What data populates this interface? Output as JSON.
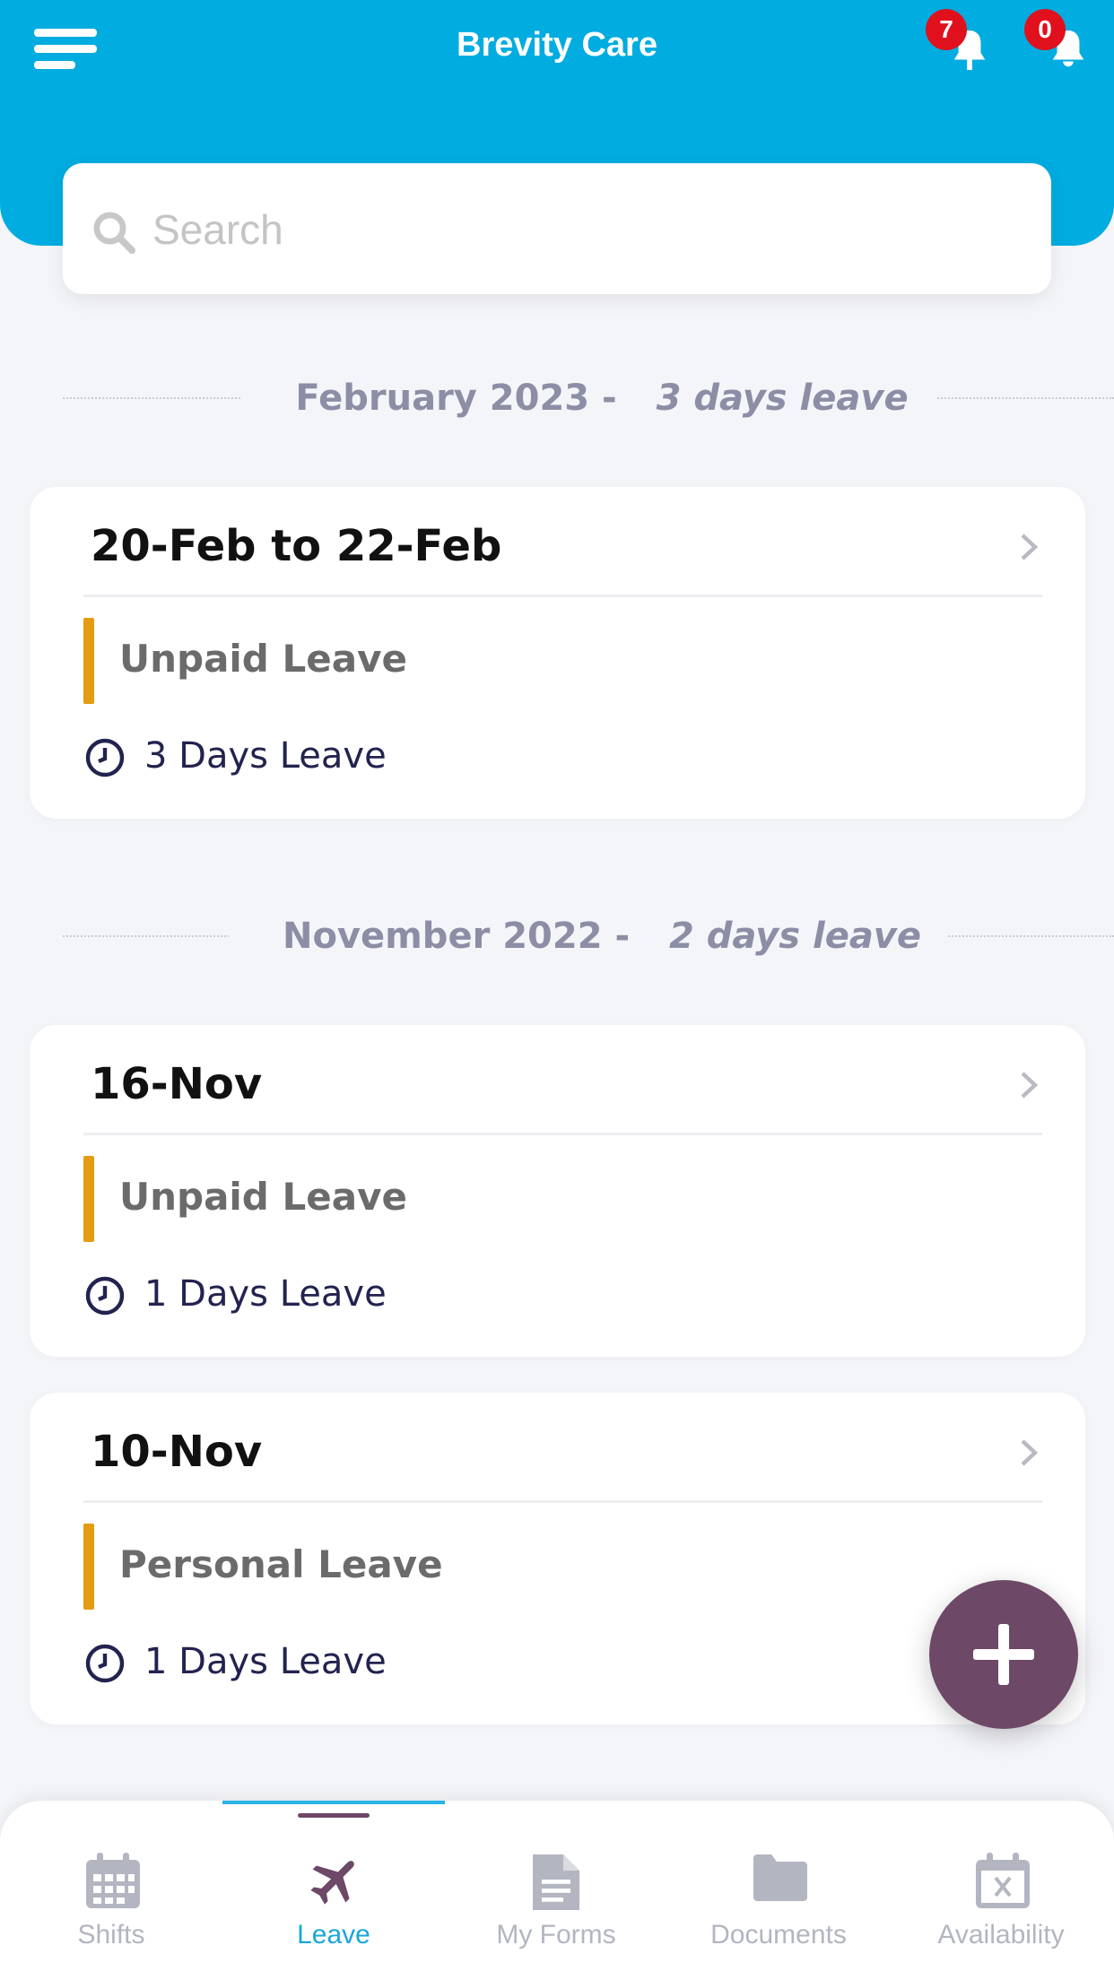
{
  "header": {
    "title": "Brevity Care",
    "notifications": [
      {
        "count": "7",
        "icon": "bell-icon"
      },
      {
        "count": "0",
        "icon": "bell-icon"
      }
    ],
    "color": "#00ace0"
  },
  "search": {
    "placeholder": "Search"
  },
  "sections": [
    {
      "month": "February 2023 - ",
      "summary": "3 days leave",
      "items": [
        {
          "date": "20-Feb to 22-Feb",
          "type": "Unpaid Leave",
          "duration": "3 Days Leave"
        }
      ]
    },
    {
      "month": "November 2022 - ",
      "summary": "2 days leave",
      "items": [
        {
          "date": "16-Nov",
          "type": "Unpaid Leave",
          "duration": "1 Days Leave"
        },
        {
          "date": "10-Nov",
          "type": "Personal Leave",
          "duration": "1 Days Leave"
        }
      ]
    }
  ],
  "fab": {
    "icon": "plus-icon",
    "color": "#6e4967"
  },
  "bottom_nav": {
    "items": [
      {
        "label": "Shifts",
        "icon": "calendar-icon",
        "active": false
      },
      {
        "label": "Leave",
        "icon": "airplane-icon",
        "active": true
      },
      {
        "label": "My Forms",
        "icon": "document-icon",
        "active": false
      },
      {
        "label": "Documents",
        "icon": "folder-icon",
        "active": false
      },
      {
        "label": "Availability",
        "icon": "calendar-x-icon",
        "active": false
      }
    ],
    "active_color": "#19a6d9"
  },
  "colors": {
    "leave_type_bar": "#e59b12",
    "badge": "#e0101c"
  }
}
